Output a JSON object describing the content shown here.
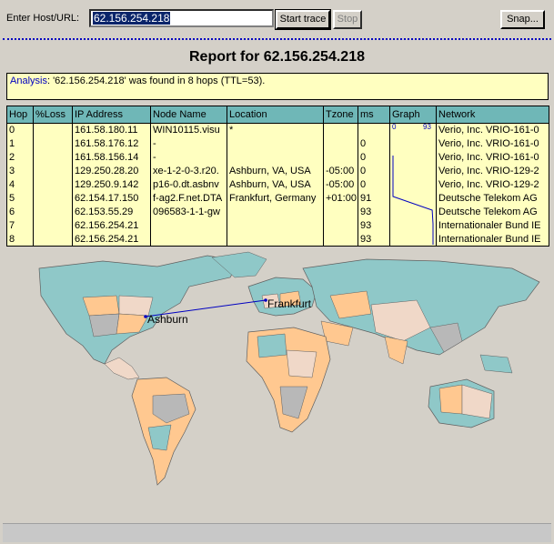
{
  "toolbar": {
    "host_label": "Enter Host/URL:",
    "host_value": "62.156.254.218",
    "start_label": "Start trace",
    "stop_label": "Stop",
    "snap_label": "Snap..."
  },
  "report": {
    "title": "Report for 62.156.254.218",
    "analysis_tag": "Analysis",
    "analysis_text": ": '62.156.254.218' was found in 8 hops (TTL=53)."
  },
  "table": {
    "headers": [
      "Hop",
      "%Loss",
      "IP Address",
      "Node Name",
      "Location",
      "Tzone",
      "ms",
      "Graph",
      "Network"
    ],
    "graph_scale": {
      "min": "0",
      "max": "93"
    },
    "rows": [
      {
        "hop": "0",
        "loss": "",
        "ip": "161.58.180.11",
        "node": "WIN10115.visu",
        "loc": "*",
        "tz": "",
        "ms": "",
        "net": "Verio, Inc. VRIO-161-0"
      },
      {
        "hop": "1",
        "loss": "",
        "ip": "161.58.176.12",
        "node": "-",
        "loc": "",
        "tz": "",
        "ms": "0",
        "net": "Verio, Inc. VRIO-161-0"
      },
      {
        "hop": "2",
        "loss": "",
        "ip": "161.58.156.14",
        "node": "-",
        "loc": "",
        "tz": "",
        "ms": "0",
        "net": "Verio, Inc. VRIO-161-0"
      },
      {
        "hop": "3",
        "loss": "",
        "ip": "129.250.28.20",
        "node": "xe-1-2-0-3.r20.",
        "loc": "Ashburn, VA, USA",
        "tz": "-05:00",
        "ms": "0",
        "net": "Verio, Inc. VRIO-129-2"
      },
      {
        "hop": "4",
        "loss": "",
        "ip": "129.250.9.142",
        "node": "p16-0.dt.asbnv",
        "loc": "Ashburn, VA, USA",
        "tz": "-05:00",
        "ms": "0",
        "net": "Verio, Inc. VRIO-129-2"
      },
      {
        "hop": "5",
        "loss": "",
        "ip": "62.154.17.150",
        "node": "f-ag2.F.net.DTA",
        "loc": "Frankfurt, Germany",
        "tz": "+01:00",
        "ms": "91",
        "net": "Deutsche Telekom AG"
      },
      {
        "hop": "6",
        "loss": "",
        "ip": "62.153.55.29",
        "node": "096583-1-1-gw",
        "loc": "",
        "tz": "",
        "ms": "93",
        "net": "Deutsche Telekom AG"
      },
      {
        "hop": "7",
        "loss": "",
        "ip": "62.156.254.21",
        "node": "",
        "loc": "",
        "tz": "",
        "ms": "93",
        "net": "Internationaler Bund IE"
      },
      {
        "hop": "8",
        "loss": "",
        "ip": "62.156.254.21",
        "node": "",
        "loc": "",
        "tz": "",
        "ms": "93",
        "net": "Internationaler Bund IE"
      }
    ]
  },
  "map": {
    "cities": [
      "Ashburn",
      "Frankfurt"
    ],
    "route_color": "#0000c0",
    "ocean": "#d4d0c8"
  },
  "colors": {
    "header_bg": "#6fb7b7",
    "row_bg": "#ffffc0",
    "land_teal": "#8fc8c8",
    "land_peach": "#ffc890",
    "land_pink": "#f0d8c8",
    "land_grey": "#b8b8b8"
  }
}
